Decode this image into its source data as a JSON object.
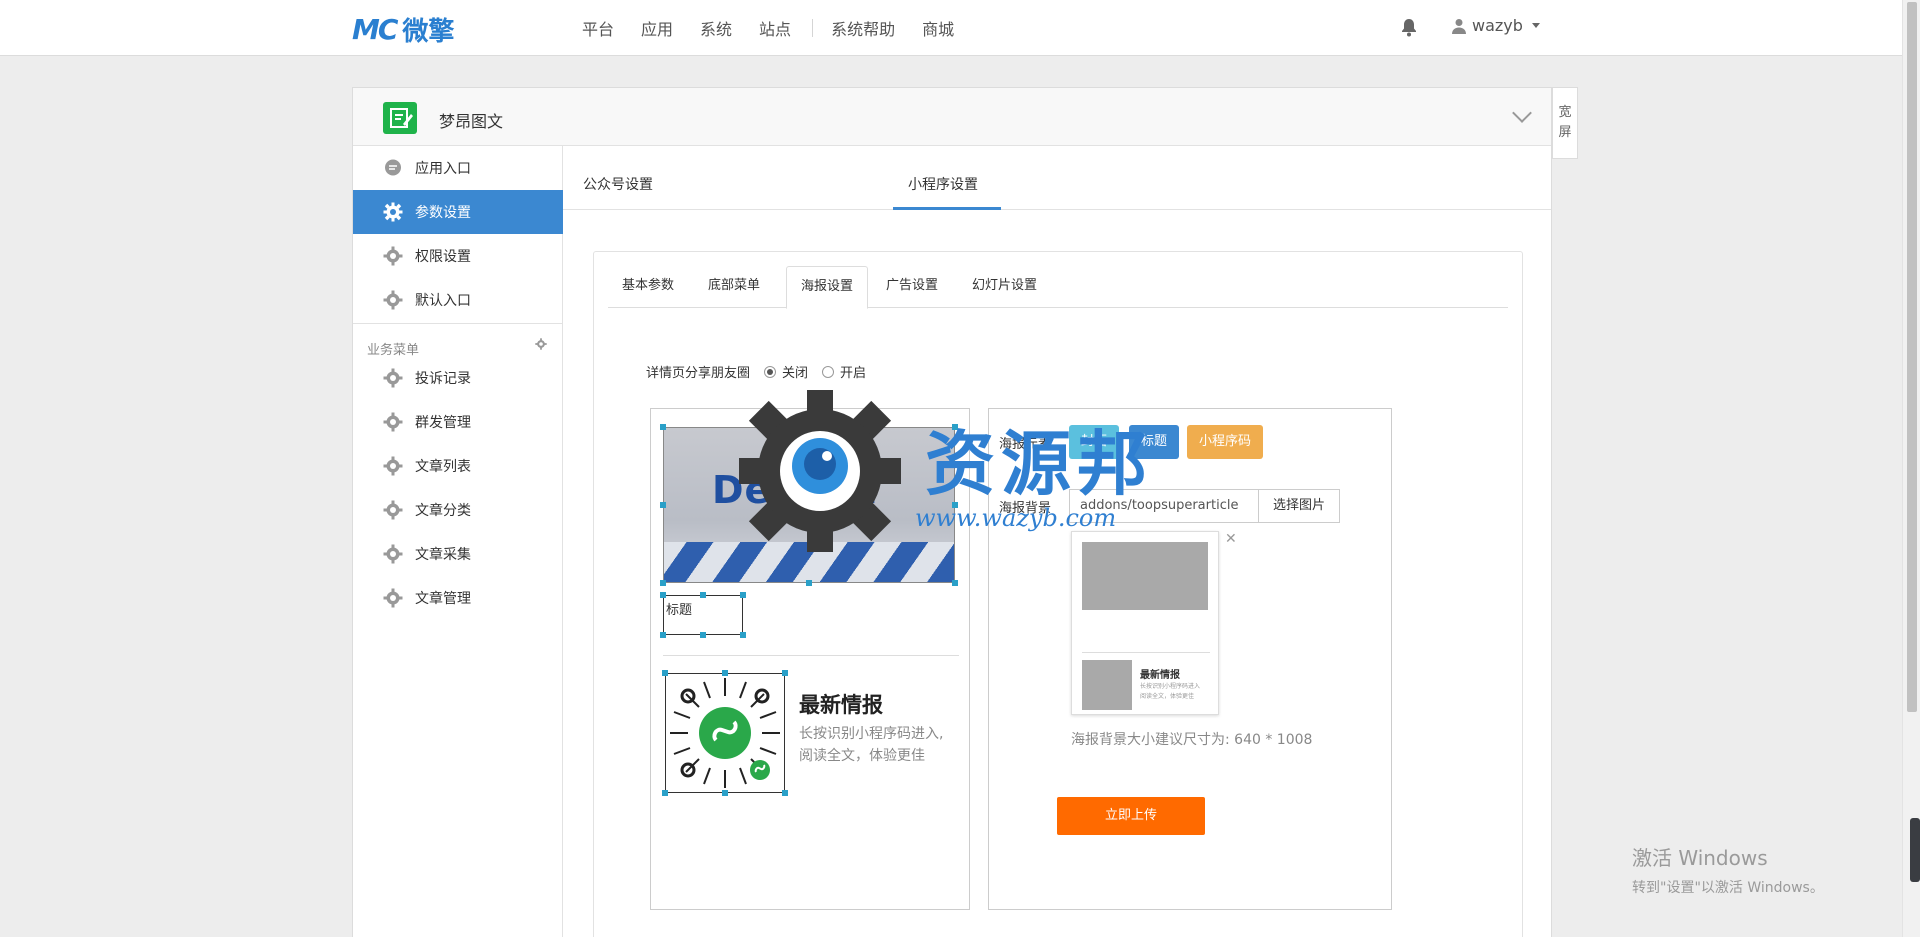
{
  "header": {
    "logo_mark": "MC",
    "logo_text": "微擎",
    "nav": [
      "平台",
      "应用",
      "系统",
      "站点",
      "系统帮助",
      "商城"
    ],
    "user": "wazyb"
  },
  "app": {
    "title": "梦昂图文",
    "wide_screen": [
      "宽",
      "屏"
    ]
  },
  "sidebar": {
    "items": [
      {
        "label": "应用入口",
        "icon": "chat-icon"
      },
      {
        "label": "参数设置",
        "icon": "gear-icon",
        "active": true
      },
      {
        "label": "权限设置",
        "icon": "gear-icon"
      },
      {
        "label": "默认入口",
        "icon": "gear-icon"
      }
    ],
    "section_title": "业务菜单",
    "business": [
      {
        "label": "投诉记录"
      },
      {
        "label": "群发管理"
      },
      {
        "label": "文章列表"
      },
      {
        "label": "文章分类"
      },
      {
        "label": "文章采集"
      },
      {
        "label": "文章管理"
      }
    ]
  },
  "tabs_main": [
    "公众号设置",
    "小程序设置"
  ],
  "tabs_sub": [
    "基本参数",
    "底部菜单",
    "海报设置",
    "广告设置",
    "幻灯片设置"
  ],
  "share": {
    "label": "详情页分享朋友圈",
    "off": "关闭",
    "on": "开启"
  },
  "poster": {
    "default_text": "Default",
    "title_text": "标题",
    "news_title": "最新情报",
    "news_desc_1": "长按识别小程序码进入,",
    "news_desc_2": "阅读全文，体验更佳"
  },
  "settings": {
    "elements_label": "海报元素",
    "btn_cover": "封面",
    "btn_title": "标题",
    "btn_qrcode": "小程序码",
    "bg_label": "海报背景",
    "bg_value": "addons/toopsuperarticle",
    "pick": "选择图片",
    "thumb_title": "最新情报",
    "thumb_desc": "长按识别小程序码进入",
    "thumb_desc2": "阅读全文，体验更佳",
    "hint": "海报背景大小建议尺寸为: 640 * 1008",
    "upload": "立即上传",
    "colors": {
      "cover": "#5bc0de",
      "title": "#3b88d1",
      "qrcode": "#f0ad4e",
      "upload": "#ff6a00"
    }
  },
  "watermark": {
    "text": "资源邦",
    "url": "www.wazyb.com"
  },
  "windows": {
    "line1": "激活 Windows",
    "line2": "转到\"设置\"以激活 Windows。"
  }
}
